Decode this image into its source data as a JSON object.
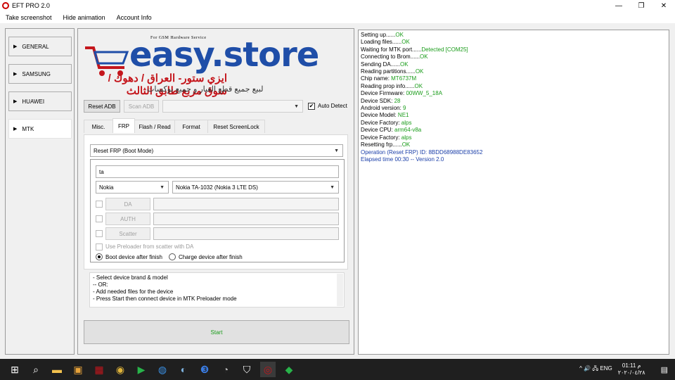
{
  "window": {
    "title": "EFT PRO 2.0",
    "controls": {
      "minimize": "—",
      "restore": "❐",
      "close": "✕"
    }
  },
  "menu": [
    "Take screenshot",
    "Hide animation",
    "Account Info"
  ],
  "brands": [
    {
      "label": "GENERAL",
      "arrow": "▶"
    },
    {
      "label": "SAMSUNG",
      "arrow": "▶"
    },
    {
      "label": "HUAWEI",
      "arrow": "▶"
    },
    {
      "label": "MTK",
      "arrow": "▶"
    }
  ],
  "logo": {
    "tagline": "For GSM Hardware Service",
    "name": "easy.store",
    "arabic_line1": "ايزي ستور- العراق / دهوك / سوق مربع طابق الثالث",
    "arabic_line2": "لبيع جميع قطع الغيار و جميع بوكسات"
  },
  "toolbar": {
    "reset_adb": "Reset ADB",
    "scan_adb": "Scan ADB",
    "port_value": "",
    "auto_detect": "Auto Detect",
    "auto_detect_checked": "✔"
  },
  "tabs": [
    "Misc.",
    "FRP",
    "Flash / Read",
    "Format",
    "Reset ScreenLock"
  ],
  "frp": {
    "operation": "Reset FRP (Boot Mode)",
    "search": "ta",
    "brand": "Nokia",
    "model": "Nokia TA-1032 (Nokia 3 LTE DS)",
    "files": [
      {
        "label": "DA",
        "value": ""
      },
      {
        "label": "AUTH",
        "value": ""
      },
      {
        "label": "Scatter",
        "value": ""
      }
    ],
    "use_preloader": "Use Preloader from scatter with DA",
    "boot_after": "Boot device after finish",
    "charge_after": "Charge device after finish"
  },
  "instructions": [
    "- Select device brand & model",
    "-- OR:",
    "- Add needed files for the device",
    "- Press Start then connect device in MTK Preloader mode"
  ],
  "start_label": "Start",
  "log": [
    {
      "text": "Setting up......",
      "status": "OK"
    },
    {
      "text": "Loading files......",
      "status": "OK"
    },
    {
      "text": "Waiting for MTK port......",
      "status": "Detected [COM25]"
    },
    {
      "text": "Connecting to Brom......",
      "status": "OK"
    },
    {
      "text": "Sending DA......",
      "status": "OK"
    },
    {
      "text": "Reading partitions......",
      "status": "OK"
    },
    {
      "text": "Chip name: ",
      "status": "MT6737M"
    },
    {
      "text": "Reading prop info......",
      "status": "OK"
    },
    {
      "text": "Device Firmware: ",
      "status": "00WW_5_18A"
    },
    {
      "text": "Device SDK: ",
      "status": "28"
    },
    {
      "text": "Android version: ",
      "status": "9"
    },
    {
      "text": "Device Model: ",
      "status": "NE1"
    },
    {
      "text": "Device Factory: ",
      "status": "alps"
    },
    {
      "text": "Device CPU: ",
      "status": "arm64-v8a"
    },
    {
      "text": "Device Factory: ",
      "status": "alps"
    },
    {
      "text": "Resetting frp......",
      "status": "OK"
    }
  ],
  "log_blue": [
    "Operation (Reset FRP) ID: 8BDD68988DE83652",
    "Elapsed time 00:30 -- Version 2.0"
  ],
  "taskbar": {
    "icons": [
      "windows-icon",
      "search-icon",
      "file-explorer-icon",
      "store-icon",
      "app-icon",
      "chrome-icon",
      "play-icon",
      "app-icon-2",
      "app-icon-3",
      "app-icon-4",
      "app-icon-5",
      "shield-icon",
      "eft-icon",
      "app-icon-6"
    ],
    "tray": "^ 🔊 🖧 ENG",
    "lang": "ENG",
    "time": "01:11 م",
    "date": "٢٠٢٠/٠٤/٢٨"
  }
}
